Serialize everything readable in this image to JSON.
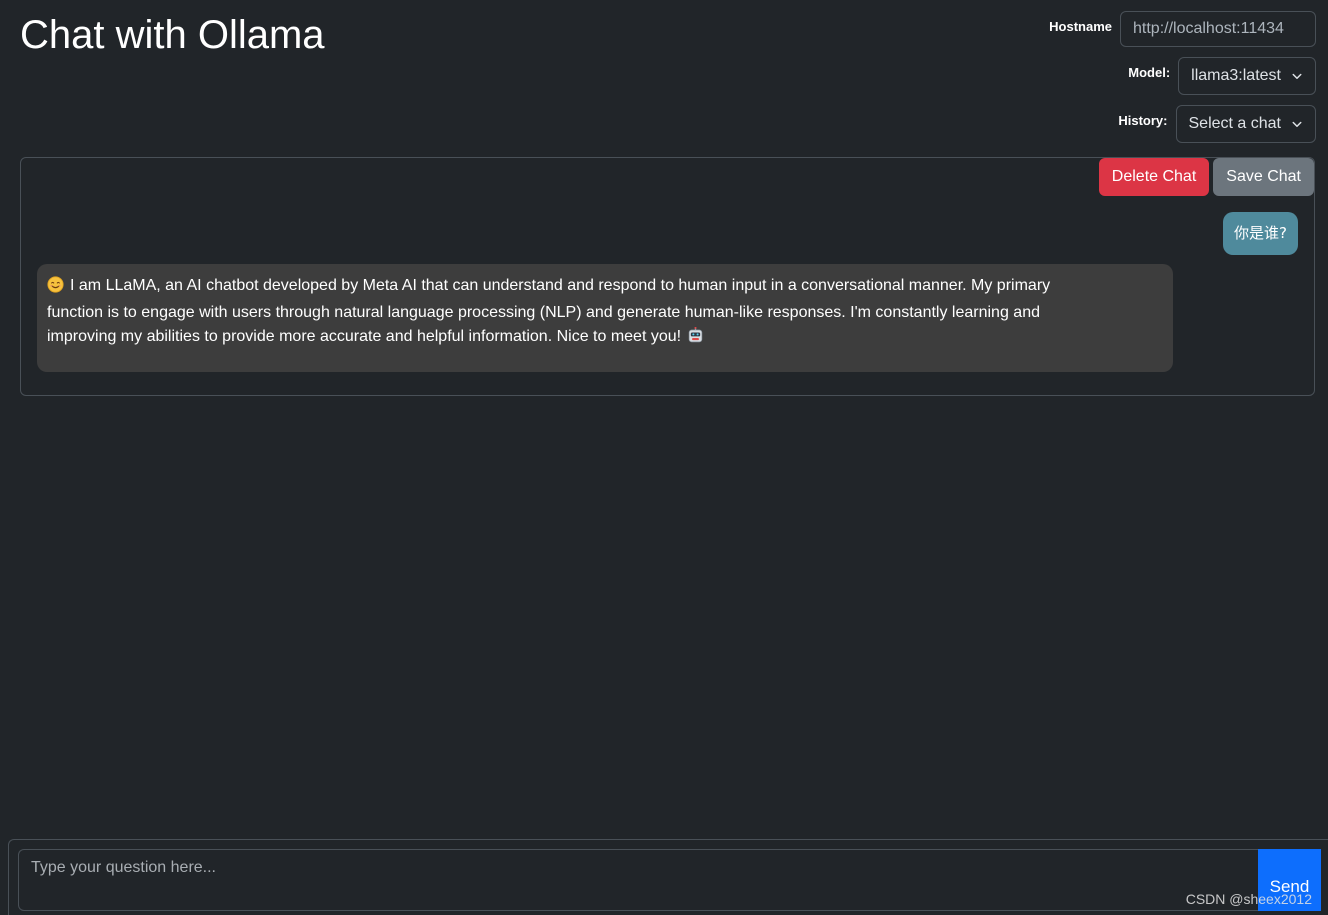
{
  "app": {
    "title": "Chat with Ollama"
  },
  "settings": {
    "hostname_label": "Hostname",
    "hostname_value": "http://localhost:11434",
    "model_label": "Model:",
    "model_selected": "llama3:latest",
    "history_label": "History:",
    "history_selected": "Select a chat"
  },
  "chat": {
    "delete_label": "Delete Chat",
    "save_label": "Save Chat",
    "messages": [
      {
        "role": "user",
        "text": "你是谁?"
      },
      {
        "role": "assistant",
        "leading_emoji": "smiling-face-icon",
        "text": "I am LLaMA, an AI chatbot developed by Meta AI that can understand and respond to human input in a conversational manner. My primary function is to engage with users through natural language processing (NLP) and generate human-like responses. I'm constantly learning and improving my abilities to provide more accurate and helpful information. Nice to meet you!",
        "trailing_emoji": "robot-face-icon"
      }
    ]
  },
  "composer": {
    "placeholder": "Type your question here...",
    "send_label": "Send"
  },
  "watermark": {
    "text": "CSDN @sheex2012"
  },
  "colors": {
    "background": "#212529",
    "border": "#495057",
    "danger": "#dc3545",
    "secondary": "#6c757d",
    "primary": "#0d6efd",
    "user_bubble": "#4f8a9c",
    "assistant_bubble": "#3d3d3d"
  }
}
